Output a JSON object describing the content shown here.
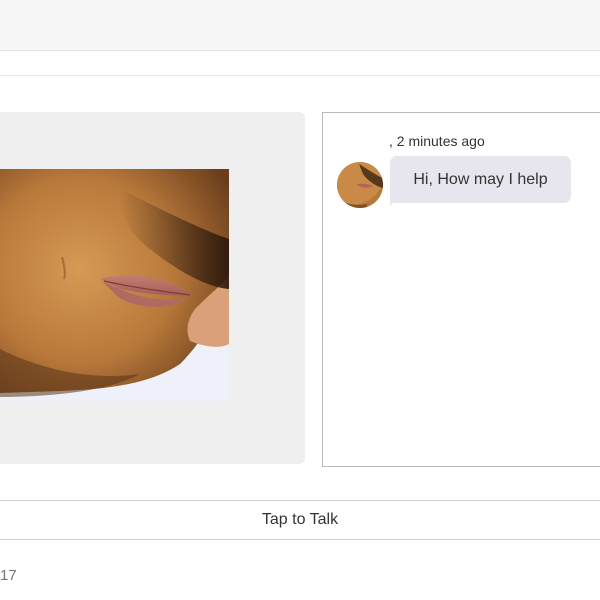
{
  "header": {},
  "avatar_stage": {
    "face": "3d-avatar-face"
  },
  "chat": {
    "messages": [
      {
        "sender": "",
        "time": "2 minutes ago",
        "text": "Hi, How may I help",
        "avatar": "3d-avatar-face"
      }
    ]
  },
  "controls": {
    "tap_to_talk_label": "Tap to Talk"
  },
  "footer": {
    "text": "17"
  },
  "colors": {
    "bubble": "#e7e6ef",
    "stage_panel": "#efefef",
    "chat_border": "#b9b9b9",
    "top_bar": "#f7f7f7"
  }
}
